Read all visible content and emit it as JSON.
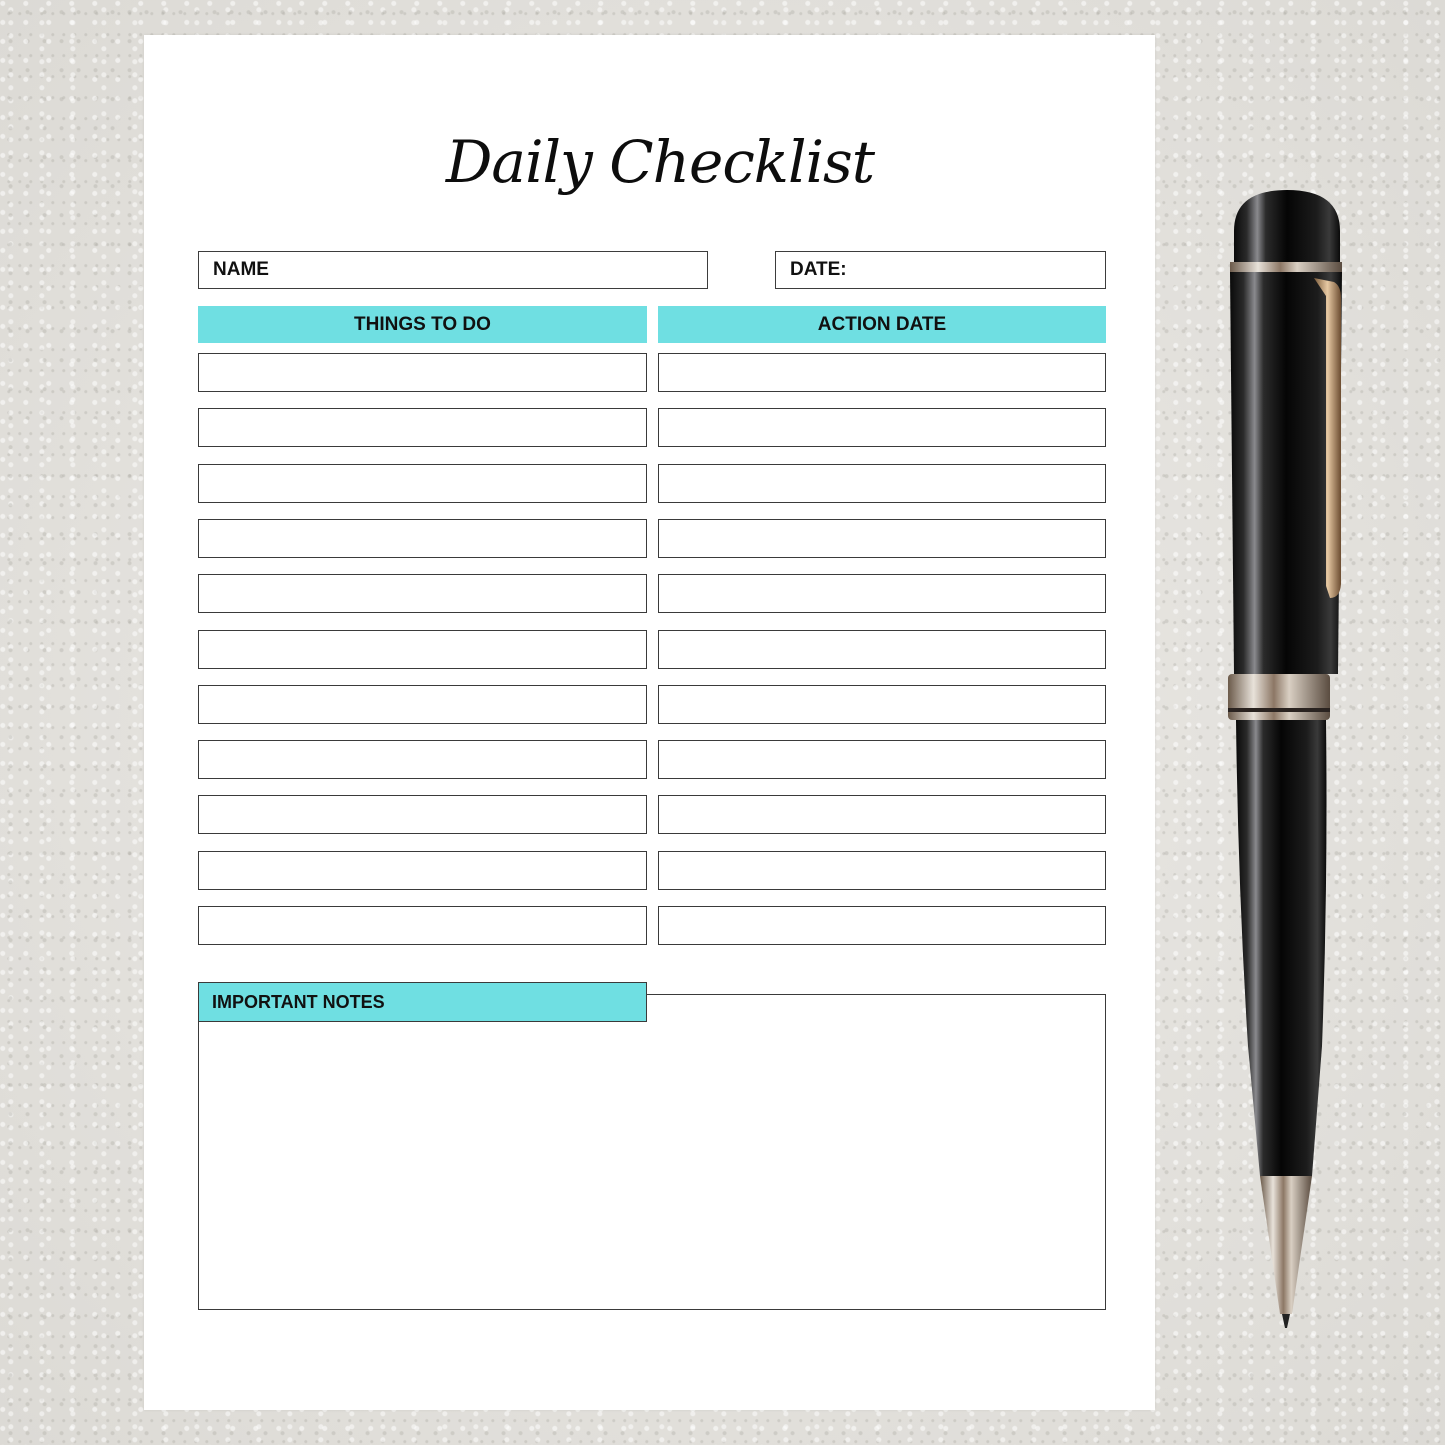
{
  "document": {
    "title": "Daily Checklist",
    "fields": {
      "name_label": "NAME",
      "date_label": "DATE:"
    },
    "columns": [
      {
        "header": "THINGS TO DO"
      },
      {
        "header": "ACTION DATE"
      }
    ],
    "row_count": 11,
    "rows": [
      {
        "things_to_do": "",
        "action_date": ""
      },
      {
        "things_to_do": "",
        "action_date": ""
      },
      {
        "things_to_do": "",
        "action_date": ""
      },
      {
        "things_to_do": "",
        "action_date": ""
      },
      {
        "things_to_do": "",
        "action_date": ""
      },
      {
        "things_to_do": "",
        "action_date": ""
      },
      {
        "things_to_do": "",
        "action_date": ""
      },
      {
        "things_to_do": "",
        "action_date": ""
      },
      {
        "things_to_do": "",
        "action_date": ""
      },
      {
        "things_to_do": "",
        "action_date": ""
      },
      {
        "things_to_do": "",
        "action_date": ""
      }
    ],
    "notes": {
      "header": "IMPORTANT NOTES",
      "content": ""
    }
  },
  "colors": {
    "accent": "#6fdfe2",
    "border": "#3a3a3a",
    "paper": "#ffffff",
    "background": "#e4e2dd"
  },
  "decor": {
    "pen_icon": "ballpoint-pen"
  }
}
